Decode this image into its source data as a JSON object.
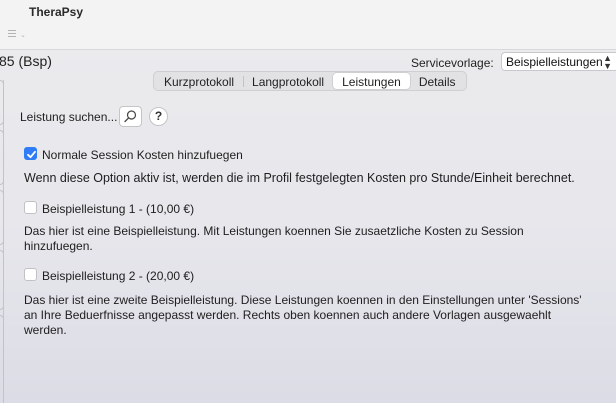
{
  "app": {
    "title": "TheraPsy"
  },
  "header": {
    "record_title": "85 (Bsp)",
    "service_template_label": "Servicevorlage:",
    "service_template_value": "Beispielleistungen"
  },
  "tabs": [
    {
      "label": "Kurzprotokoll",
      "active": false
    },
    {
      "label": "Langprotokoll",
      "active": false
    },
    {
      "label": "Leistungen",
      "active": true
    },
    {
      "label": "Details",
      "active": false
    }
  ],
  "search": {
    "label": "Leistung suchen...",
    "help_label": "?"
  },
  "session_costs": {
    "checked": true,
    "label": "Normale Session Kosten hinzufuegen",
    "description": "Wenn diese Option aktiv ist, werden die im Profil festgelegten Kosten pro Stunde/Einheit berechnet."
  },
  "services": [
    {
      "checked": false,
      "label": "Beispielleistung 1 - (10,00 €)",
      "description": "Das hier ist eine Beispielleistung. Mit Leistungen koennen Sie zusaetzliche Kosten zu Session hinzufuegen."
    },
    {
      "checked": false,
      "label": "Beispielleistung 2 - (20,00 €)",
      "description": "Das hier ist eine zweite Beispielleistung. Diese Leistungen koennen in den Einstellungen unter 'Sessions' an Ihre Beduerfnisse angepasst werden. Rechts oben koennen auch andere Vorlagen ausgewaehlt werden."
    }
  ],
  "icons": {
    "list": "list-icon",
    "search": "magnifier-icon",
    "select": "up-down-chevron-icon",
    "checkmark": "checkmark-icon"
  },
  "colors": {
    "accent": "#2f7cf6"
  }
}
